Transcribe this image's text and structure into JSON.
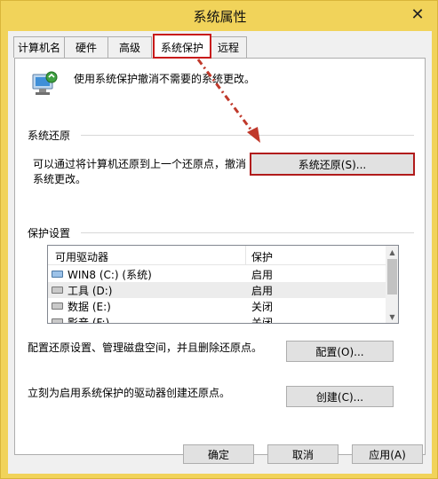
{
  "window": {
    "title": "系统属性",
    "close_glyph": "✕"
  },
  "tabs": [
    {
      "label": "计算机名"
    },
    {
      "label": "硬件"
    },
    {
      "label": "高级"
    },
    {
      "label": "系统保护"
    },
    {
      "label": "远程"
    }
  ],
  "intro": {
    "text": "使用系统保护撤消不需要的系统更改。"
  },
  "restore": {
    "heading": "系统还原",
    "desc_line1": "可以通过将计算机还原到上一个还原点，撤消",
    "desc_line2": "系统更改。",
    "button": "系统还原(S)..."
  },
  "protection": {
    "heading": "保护设置",
    "columns": [
      "可用驱动器",
      "保护"
    ],
    "rows": [
      {
        "drive": "WIN8 (C:) (系统)",
        "status": "启用"
      },
      {
        "drive": "工具 (D:)",
        "status": "启用"
      },
      {
        "drive": "数据 (E:)",
        "status": "关闭"
      },
      {
        "drive": "影音 (F:)",
        "status": "关闭"
      }
    ]
  },
  "configure": {
    "text": "配置还原设置、管理磁盘空间，并且删除还原点。",
    "button": "配置(O)..."
  },
  "create": {
    "text": "立刻为启用系统保护的驱动器创建还原点。",
    "button": "创建(C)..."
  },
  "footer": {
    "ok": "确定",
    "cancel": "取消",
    "apply": "应用(A)"
  },
  "colors": {
    "highlight_red": "#c81a1a",
    "arrow_red": "#c0392b"
  }
}
